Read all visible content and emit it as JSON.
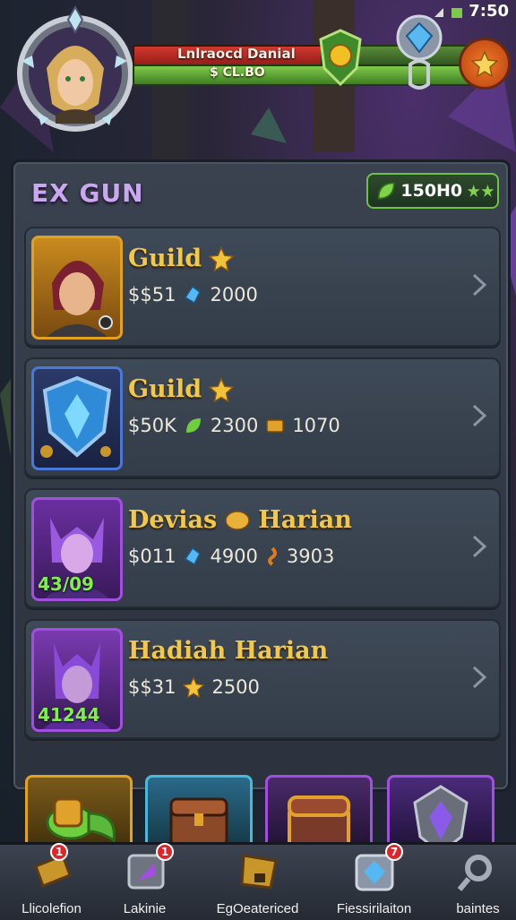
{
  "status": {
    "time": "7:50"
  },
  "header": {
    "player_name": "Lnlraocd Danial",
    "player_sub": "$ CL.BO"
  },
  "panel": {
    "title": "EX GUN",
    "currency_value": "150H0"
  },
  "rows": [
    {
      "name": "Guild",
      "gold": "$$51",
      "gem": "2000",
      "extra": "",
      "level": "",
      "frame_color": "#e0a21f"
    },
    {
      "name": "Guild",
      "gold": "$50K",
      "gem": "2300",
      "extra": "1070",
      "level": "",
      "frame_color": "#4a78d8"
    },
    {
      "name": "Devias",
      "name2": "Harian",
      "gold": "$011",
      "gem": "4900",
      "extra": "3903",
      "level": "43/09",
      "frame_color": "#a24fe0"
    },
    {
      "name": "Hadiah Harian",
      "gold": "$$31",
      "gem": "2500",
      "extra": "",
      "level": "41244",
      "frame_color": "#a24fe0"
    }
  ],
  "nav": [
    {
      "label": "Llicolefion",
      "badge": "1"
    },
    {
      "label": "Lakinie",
      "badge": "1"
    },
    {
      "label": "EgOeatericed",
      "badge": ""
    },
    {
      "label": "Fiessirilaiton",
      "badge": "7"
    },
    {
      "label": "baintes",
      "badge": ""
    }
  ],
  "colors": {
    "accent_gold": "#f2c84a",
    "title_purple": "#c9a8f0",
    "level_green": "#7ff04a"
  }
}
